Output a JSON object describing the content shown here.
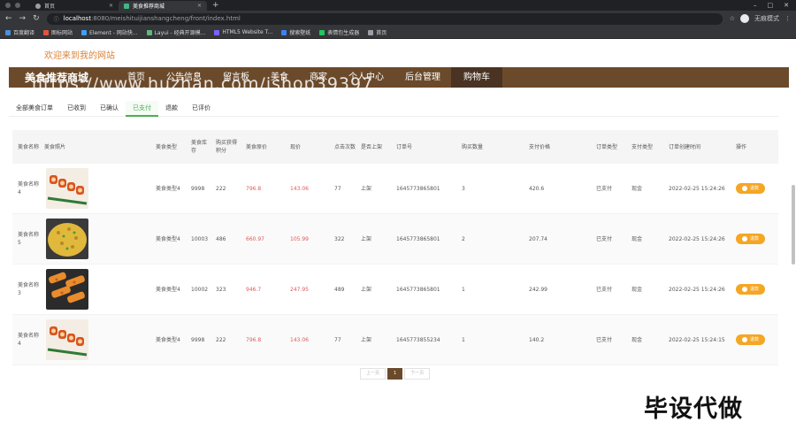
{
  "browser": {
    "tabs": [
      {
        "title": "首页",
        "active": false
      },
      {
        "title": "美食推荐商城",
        "active": true
      }
    ],
    "url_host": "localhost",
    "url_path": ":8080/meishituijianshangcheng/front/index.html",
    "profile_label": "无痕模式",
    "bookmarks": [
      "百度翻译",
      "图标网站",
      "Element - 网站快...",
      "Layui - 经典开源模...",
      "HTML5 Website T...",
      "搜索壁纸",
      "表情包生成器",
      "首页"
    ]
  },
  "site": {
    "welcome": "欢迎来到我的网站",
    "brand": "美食推荐商城",
    "nav": [
      "首页",
      "公告信息",
      "留言板",
      "美食",
      "商家",
      "个人中心",
      "后台管理",
      "购物车"
    ],
    "watermark": "https://www.huzhan.com/ishop39397",
    "subtabs": [
      "全部美食订单",
      "已收到",
      "已确认",
      "已支付",
      "退款",
      "已评价"
    ]
  },
  "table": {
    "headers": [
      "美食名称",
      "美食照片",
      "美食类型",
      "美食库存",
      "购买获得积分",
      "美食原价",
      "现价",
      "点击次数",
      "是否上架",
      "订单号",
      "购买数量",
      "支付价格",
      "订单类型",
      "支付类型",
      "订单创建时间",
      "操作"
    ],
    "rows": [
      {
        "name": "美食名称4",
        "type": "美食类型4",
        "stock": "9998",
        "points": "222",
        "orig": "796.8",
        "price": "143.06",
        "clicks": "77",
        "status": "上架",
        "order": "1645773865801",
        "qty": "3",
        "pay": "420.6",
        "otype": "已支付",
        "ptype": "现金",
        "time": "2022-02-25 15:24:26",
        "action": "退款"
      },
      {
        "name": "美食名称5",
        "type": "美食类型4",
        "stock": "10003",
        "points": "486",
        "orig": "660.97",
        "price": "105.99",
        "clicks": "322",
        "status": "上架",
        "order": "1645773865801",
        "qty": "2",
        "pay": "207.74",
        "otype": "已支付",
        "ptype": "现金",
        "time": "2022-02-25 15:24:26",
        "action": "退款"
      },
      {
        "name": "美食名称3",
        "type": "美食类型4",
        "stock": "10002",
        "points": "323",
        "orig": "946.7",
        "price": "247.95",
        "clicks": "489",
        "status": "上架",
        "order": "1645773865801",
        "qty": "1",
        "pay": "242.99",
        "otype": "已支付",
        "ptype": "现金",
        "time": "2022-02-25 15:24:26",
        "action": "退款"
      },
      {
        "name": "美食名称4",
        "type": "美食类型4",
        "stock": "9998",
        "points": "222",
        "orig": "796.8",
        "price": "143.06",
        "clicks": "77",
        "status": "上架",
        "order": "1645773855234",
        "qty": "1",
        "pay": "140.2",
        "otype": "已支付",
        "ptype": "现金",
        "time": "2022-02-25 15:24:15",
        "action": "退款"
      }
    ]
  },
  "pager": {
    "prev": "上一页",
    "current": "1",
    "next": "下一页"
  },
  "stamp": "毕设代做",
  "colors": {
    "nav_bg": "#6b4a2b",
    "accent": "#d9833a",
    "button": "#f5a623",
    "price_red": "#e05a5a"
  }
}
